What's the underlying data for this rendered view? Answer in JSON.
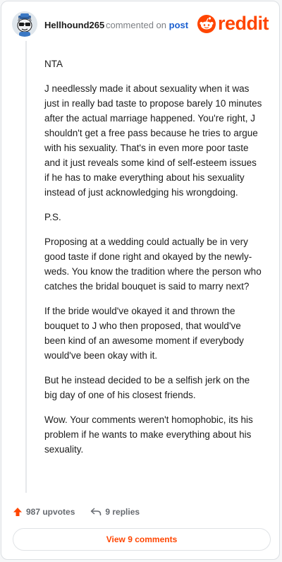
{
  "comment": {
    "username": "Hellhound265",
    "action_text": "commented on",
    "post_link_label": "post",
    "paragraphs": [
      "NTA",
      "J needlessly made it about sexuality when it was just in really bad taste to propose barely 10 minutes after the actual marriage happened. You're right, J shouldn't get a free pass because he tries to argue with his sexuality. That's in even more poor taste and it just reveals some kind of self-esteem issues if he has to make everything about his sexuality instead of just acknowledging his wrongdoing.",
      "P.S.",
      "Proposing at a wedding could actually be in very good taste if done right and okayed by the newly-weds. You know the tradition where the person who catches the bridal bouquet is said to marry next?",
      "If the bride would've okayed it and thrown the bouquet to J who then proposed, that would've been kind of an awesome moment if everybody would've been okay with it.",
      "But he instead decided to be a selfish jerk on the big day of one of his closest friends.",
      "Wow. Your comments weren't homophobic, its his problem if he wants to make everything about his sexuality."
    ]
  },
  "brand": {
    "logo_text": "reddit",
    "color": "#ff4500"
  },
  "actions": {
    "upvotes_label": "987 upvotes",
    "replies_label": "9 replies",
    "view_comments_label": "View 9 comments"
  },
  "icons": {
    "upvote": "upvote-arrow-icon",
    "reply": "reply-arrow-icon",
    "snoo": "reddit-snoo-icon",
    "avatar": "user-avatar"
  }
}
